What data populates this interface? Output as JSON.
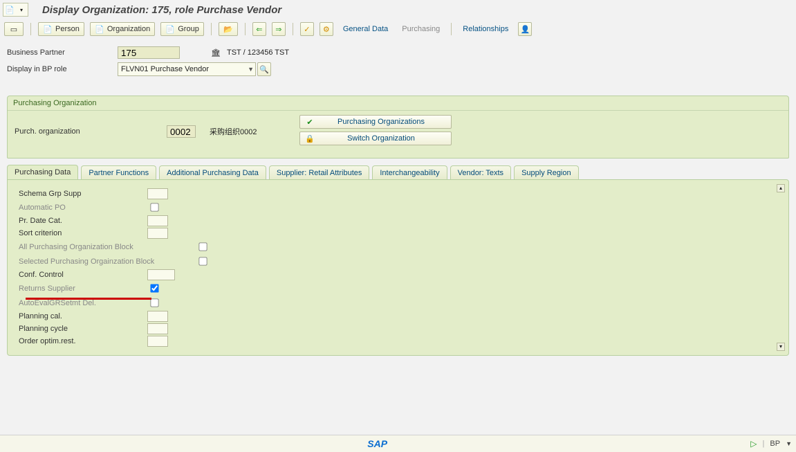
{
  "title": "Display Organization: 175, role Purchase Vendor",
  "toolbar": {
    "person": "Person",
    "organization": "Organization",
    "group": "Group",
    "general_data": "General Data",
    "purchasing": "Purchasing",
    "relationships": "Relationships"
  },
  "header": {
    "bp_label": "Business Partner",
    "bp_value": "175",
    "bp_desc": "TST / 123456 TST",
    "role_label": "Display in BP role",
    "role_value": "FLVN01 Purchase Vendor"
  },
  "panel": {
    "title": "Purchasing Organization",
    "purch_org_label": "Purch. organization",
    "purch_org_value": "0002",
    "purch_org_desc": "采购组织0002",
    "btn_purch_orgs": "Purchasing Organizations",
    "btn_switch_org": "Switch Organization"
  },
  "tabs": {
    "purchasing_data": "Purchasing Data",
    "partner_functions": "Partner Functions",
    "additional_purchasing": "Additional Purchasing Data",
    "supplier_retail": "Supplier: Retail Attributes",
    "interchange": "Interchangeability",
    "vendor_texts": "Vendor: Texts",
    "supply_region": "Supply Region"
  },
  "purchasing_data_fields": {
    "schema_grp": {
      "label": "Schema Grp Supp",
      "value": "",
      "type": "text",
      "disabled": false
    },
    "automatic_po": {
      "label": "Automatic PO",
      "value": false,
      "type": "check",
      "disabled": true
    },
    "pr_date_cat": {
      "label": "Pr. Date Cat.",
      "value": "",
      "type": "text",
      "disabled": false
    },
    "sort_criterion": {
      "label": "Sort criterion",
      "value": "",
      "type": "text",
      "disabled": false
    },
    "all_purch_block": {
      "label": "All Purchasing Organization Block",
      "value": false,
      "type": "check_far",
      "disabled": true
    },
    "sel_purch_block": {
      "label": "Selected Purchasing Orgainzation Block",
      "value": false,
      "type": "check_far",
      "disabled": true
    },
    "conf_control": {
      "label": "Conf. Control",
      "value": "",
      "type": "text_wide",
      "disabled": false
    },
    "returns_supplier": {
      "label": "Returns Supplier",
      "value": true,
      "type": "check",
      "disabled": true
    },
    "autoeval": {
      "label": "AutoEvalGRSetmt Del.",
      "value": false,
      "type": "check",
      "disabled": true
    },
    "planning_cal": {
      "label": "Planning cal.",
      "value": "",
      "type": "text",
      "disabled": false
    },
    "planning_cycle": {
      "label": "Planning cycle",
      "value": "",
      "type": "text",
      "disabled": false
    },
    "order_optim": {
      "label": "Order optim.rest.",
      "value": "",
      "type": "text",
      "disabled": false
    }
  },
  "status": {
    "bp": "BP"
  }
}
